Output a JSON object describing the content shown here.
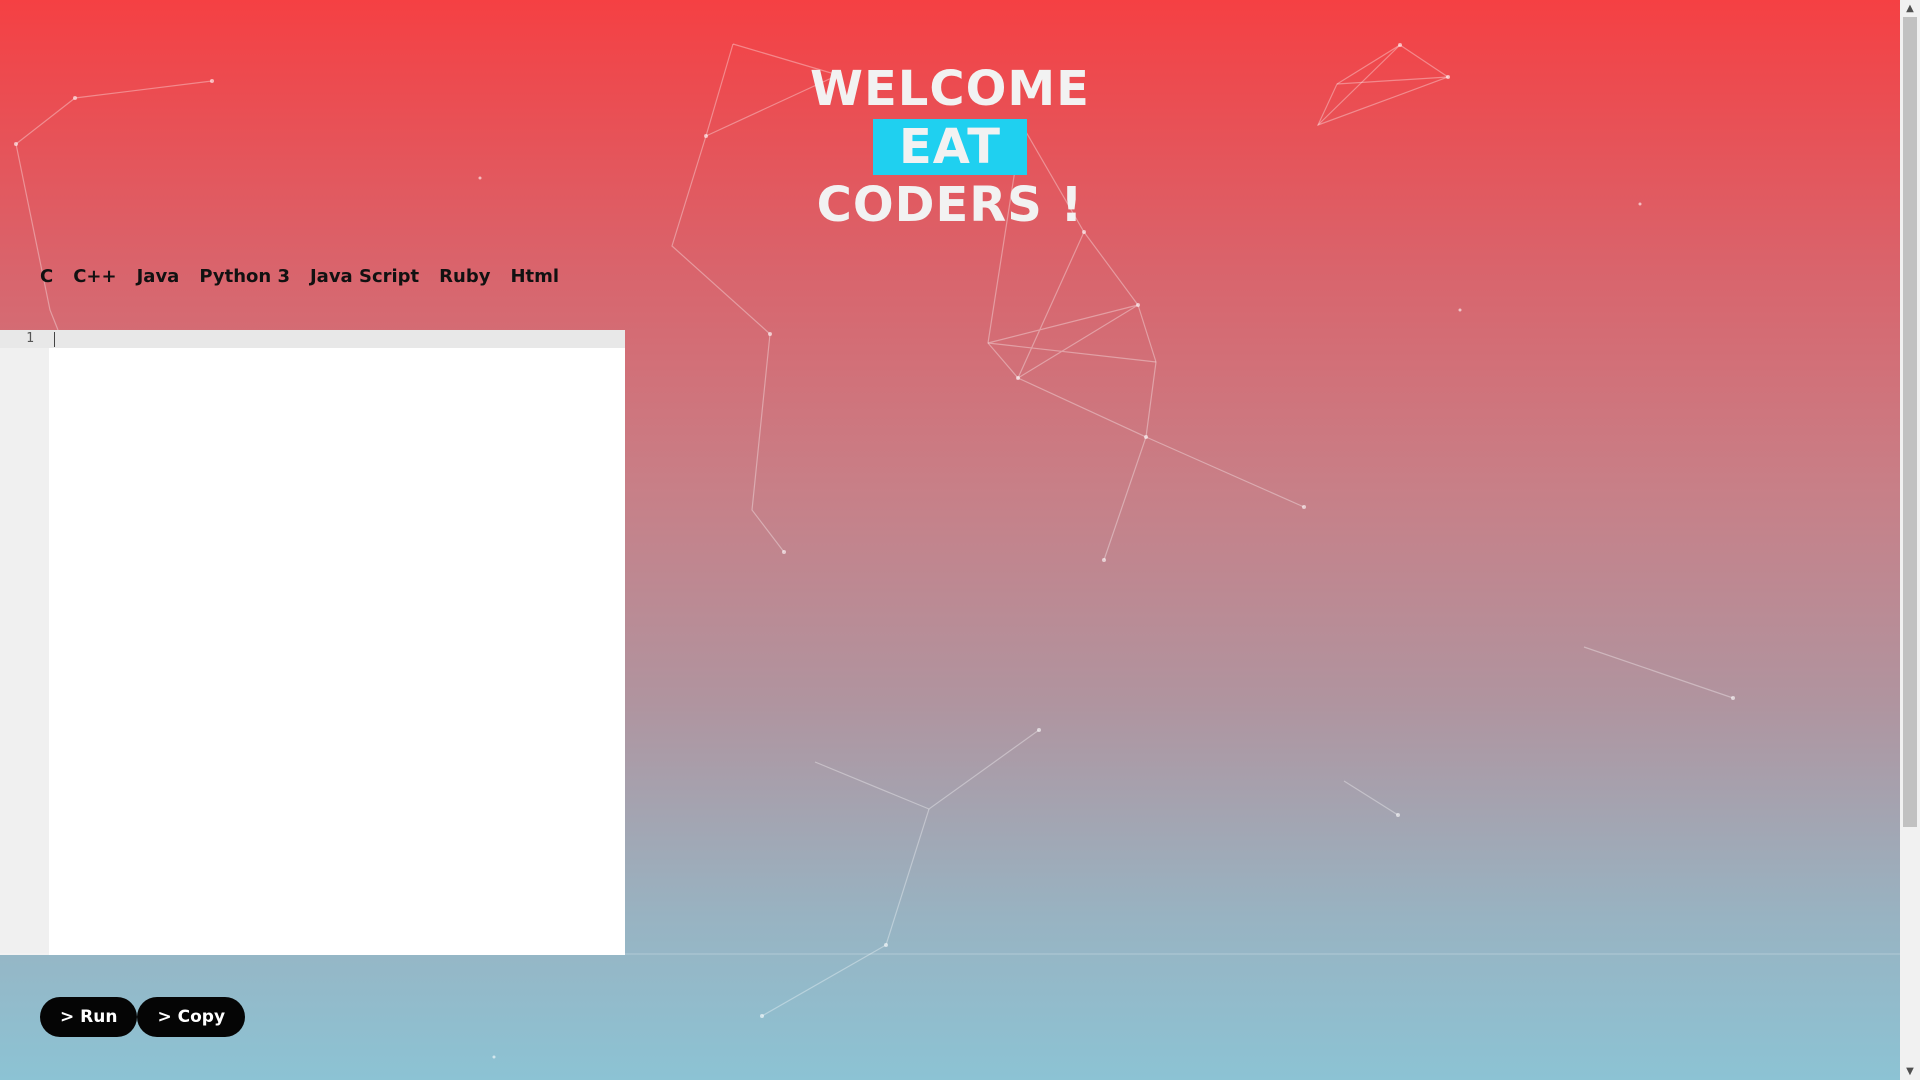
{
  "header": {
    "line1": "WELCOME",
    "line2": "EAT",
    "line3": "CODERS !"
  },
  "languages": [
    "C",
    "C++",
    "Java",
    "Python 3",
    "Java Script",
    "Ruby",
    "Html"
  ],
  "editor": {
    "line_numbers": [
      "1"
    ],
    "content": ""
  },
  "actions": {
    "run_label": "> Run",
    "copy_label": "> Copy"
  },
  "colors": {
    "gradient_top": "#f54043",
    "gradient_bottom": "#8cc3d4",
    "eat_highlight": "#1fd0f0",
    "button_bg": "#050505"
  }
}
